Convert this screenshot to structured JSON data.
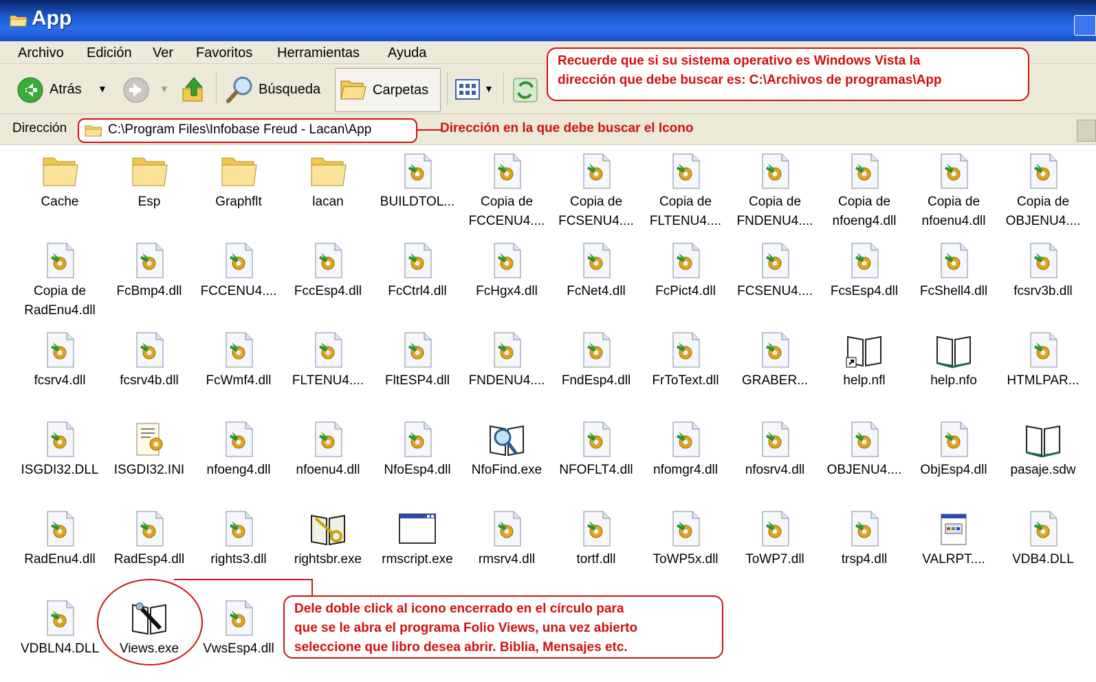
{
  "window": {
    "title": "App"
  },
  "menu": [
    "Archivo",
    "Edición",
    "Ver",
    "Favoritos",
    "Herramientas",
    "Ayuda"
  ],
  "toolbar": {
    "back_label": "Atrás",
    "search_label": "Búsqueda",
    "folders_label": "Carpetas"
  },
  "address": {
    "label": "Dirección",
    "path": "C:\\Program Files\\Infobase Freud - Lacan\\App",
    "note": "Dirección en la que debe buscar el Icono"
  },
  "callouts": {
    "vista_line1": "Recuerde que si su sistema operativo es Windows Vista la",
    "vista_line2": "dirección que debe buscar es: C:\\Archivos de programas\\App",
    "views_line1": "Dele doble click al icono encerrado en el círculo para",
    "views_line2": "que se le abra el programa Folio Views, una vez abierto",
    "views_line3": "seleccione que libro desea abrir. Biblia, Mensajes etc."
  },
  "files": [
    {
      "name": "Cache",
      "icon": "folder"
    },
    {
      "name": "Esp",
      "icon": "folder"
    },
    {
      "name": "Graphflt",
      "icon": "folder"
    },
    {
      "name": "lacan",
      "icon": "folder"
    },
    {
      "name": "BUILDTOL...",
      "icon": "dll"
    },
    {
      "name": "Copia de\nFCCENU4....",
      "icon": "dll"
    },
    {
      "name": "Copia de\nFCSENU4....",
      "icon": "dll"
    },
    {
      "name": "Copia de\nFLTENU4....",
      "icon": "dll"
    },
    {
      "name": "Copia de\nFNDENU4....",
      "icon": "dll"
    },
    {
      "name": "Copia de\nnfoeng4.dll",
      "icon": "dll"
    },
    {
      "name": "Copia de\nnfoenu4.dll",
      "icon": "dll"
    },
    {
      "name": "Copia de\nOBJENU4....",
      "icon": "dll"
    },
    {
      "name": "Copia de\nRadEnu4.dll",
      "icon": "dll"
    },
    {
      "name": "FcBmp4.dll",
      "icon": "dll"
    },
    {
      "name": "FCCENU4....",
      "icon": "dll"
    },
    {
      "name": "FccEsp4.dll",
      "icon": "dll"
    },
    {
      "name": "FcCtrl4.dll",
      "icon": "dll"
    },
    {
      "name": "FcHgx4.dll",
      "icon": "dll"
    },
    {
      "name": "FcNet4.dll",
      "icon": "dll"
    },
    {
      "name": "FcPict4.dll",
      "icon": "dll"
    },
    {
      "name": "FCSENU4....",
      "icon": "dll"
    },
    {
      "name": "FcsEsp4.dll",
      "icon": "dll"
    },
    {
      "name": "FcShell4.dll",
      "icon": "dll"
    },
    {
      "name": "fcsrv3b.dll",
      "icon": "dll"
    },
    {
      "name": "fcsrv4.dll",
      "icon": "dll"
    },
    {
      "name": "fcsrv4b.dll",
      "icon": "dll"
    },
    {
      "name": "FcWmf4.dll",
      "icon": "dll"
    },
    {
      "name": "FLTENU4....",
      "icon": "dll"
    },
    {
      "name": "FltESP4.dll",
      "icon": "dll"
    },
    {
      "name": "FNDENU4....",
      "icon": "dll"
    },
    {
      "name": "FndEsp4.dll",
      "icon": "dll"
    },
    {
      "name": "FrToText.dll",
      "icon": "dll"
    },
    {
      "name": "GRABER...",
      "icon": "dll"
    },
    {
      "name": "help.nfl",
      "icon": "book-shortcut"
    },
    {
      "name": "help.nfo",
      "icon": "book"
    },
    {
      "name": "HTMLPAR...",
      "icon": "dll"
    },
    {
      "name": "ISGDI32.DLL",
      "icon": "dll"
    },
    {
      "name": "ISGDI32.INI",
      "icon": "ini"
    },
    {
      "name": "nfoeng4.dll",
      "icon": "dll"
    },
    {
      "name": "nfoenu4.dll",
      "icon": "dll"
    },
    {
      "name": "NfoEsp4.dll",
      "icon": "dll"
    },
    {
      "name": "NfoFind.exe",
      "icon": "book-search"
    },
    {
      "name": "NFOFLT4.dll",
      "icon": "dll"
    },
    {
      "name": "nfomgr4.dll",
      "icon": "dll"
    },
    {
      "name": "nfosrv4.dll",
      "icon": "dll"
    },
    {
      "name": "OBJENU4....",
      "icon": "dll"
    },
    {
      "name": "ObjEsp4.dll",
      "icon": "dll"
    },
    {
      "name": "pasaje.sdw",
      "icon": "book"
    },
    {
      "name": "RadEnu4.dll",
      "icon": "dll"
    },
    {
      "name": "RadEsp4.dll",
      "icon": "dll"
    },
    {
      "name": "rights3.dll",
      "icon": "dll"
    },
    {
      "name": "rightsbr.exe",
      "icon": "book-key"
    },
    {
      "name": "rmscript.exe",
      "icon": "window"
    },
    {
      "name": "rmsrv4.dll",
      "icon": "dll"
    },
    {
      "name": "tortf.dll",
      "icon": "dll"
    },
    {
      "name": "ToWP5x.dll",
      "icon": "dll"
    },
    {
      "name": "ToWP7.dll",
      "icon": "dll"
    },
    {
      "name": "trsp4.dll",
      "icon": "dll"
    },
    {
      "name": "VALRPT....",
      "icon": "report"
    },
    {
      "name": "VDB4.DLL",
      "icon": "dll"
    },
    {
      "name": "VDBLN4.DLL",
      "icon": "dll"
    },
    {
      "name": "Views.exe",
      "icon": "book-pen"
    },
    {
      "name": "VwsEsp4.dll",
      "icon": "dll"
    }
  ]
}
